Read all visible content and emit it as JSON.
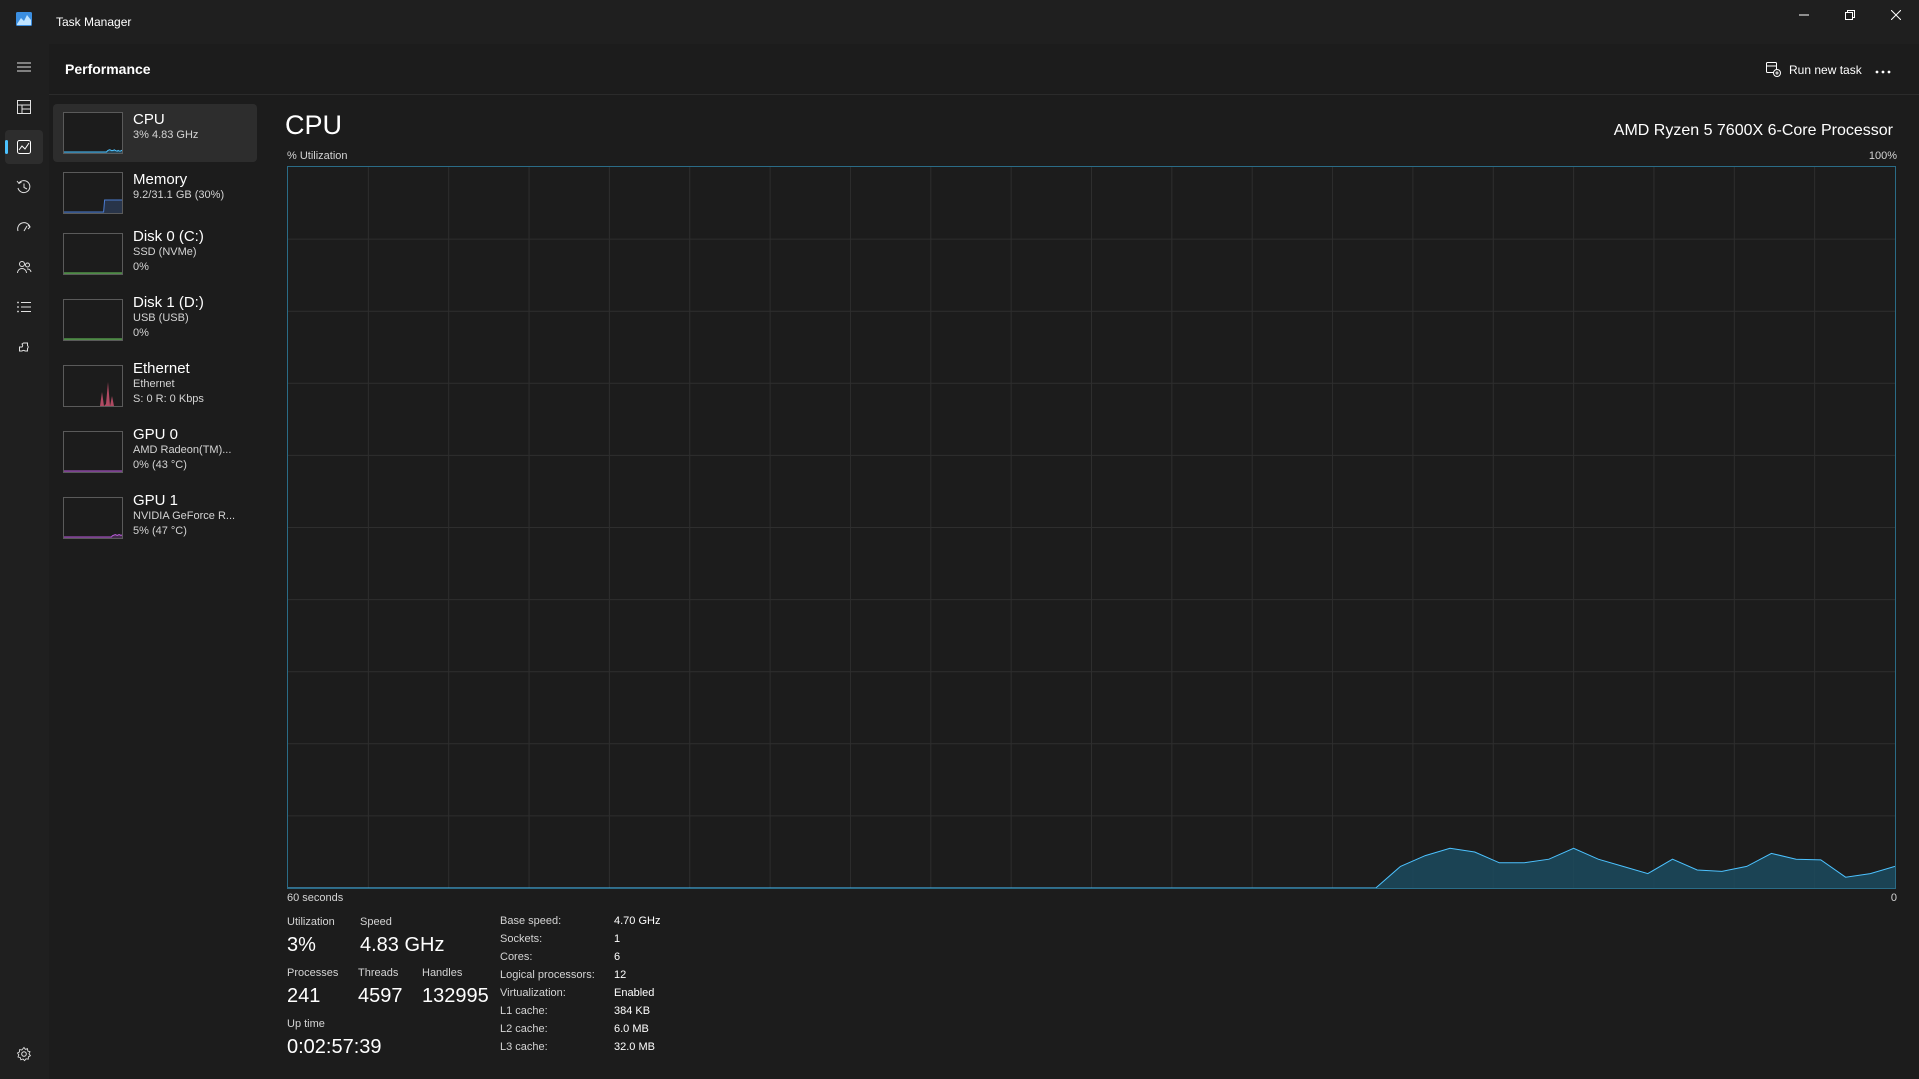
{
  "window": {
    "title": "Task Manager",
    "icon": "task-manager-logo-icon",
    "controls": [
      "minimize-icon",
      "restore-icon",
      "close-icon"
    ]
  },
  "nav": {
    "items": [
      "hamburger-menu-icon",
      "processes-icon",
      "performance-icon",
      "app-history-icon",
      "startup-apps-icon",
      "users-icon",
      "details-icon",
      "services-icon"
    ],
    "active": "performance-icon",
    "footer": "settings-gear-icon"
  },
  "header": {
    "title": "Performance",
    "run_new_task": "Run new task",
    "more_icon": "more-options-icon"
  },
  "resources": [
    {
      "name": "CPU",
      "sub1": "3%  4.83 GHz",
      "sub2": "",
      "graph_color": "#4cc2ff"
    },
    {
      "name": "Memory",
      "sub1": "9.2/31.1 GB (30%)",
      "sub2": "",
      "graph_color": "#4a7bd1"
    },
    {
      "name": "Disk 0 (C:)",
      "sub1": "SSD (NVMe)",
      "sub2": "0%",
      "graph_color": "#6ccb5f"
    },
    {
      "name": "Disk 1 (D:)",
      "sub1": "USB (USB)",
      "sub2": "0%",
      "graph_color": "#6ccb5f"
    },
    {
      "name": "Ethernet",
      "sub1": "Ethernet",
      "sub2": "S: 0  R: 0 Kbps",
      "graph_color": "#e0597a"
    },
    {
      "name": "GPU 0",
      "sub1": "AMD Radeon(TM)...",
      "sub2": "0% (43 °C)",
      "graph_color": "#b65ad6"
    },
    {
      "name": "GPU 1",
      "sub1": "NVIDIA GeForce R...",
      "sub2": "5% (47 °C)",
      "graph_color": "#b65ad6"
    }
  ],
  "detail": {
    "title": "CPU",
    "model": "AMD Ryzen 5 7600X 6-Core Processor",
    "y_label": "% Utilization",
    "y_max_label": "100%",
    "x_left_label": "60 seconds",
    "x_right_label": "0"
  },
  "chart_data": {
    "type": "area",
    "title": "",
    "xlabel": "60 seconds",
    "ylabel": "% Utilization",
    "xlim": [
      60,
      0
    ],
    "ylim": [
      0,
      100
    ],
    "grid": true,
    "color": "#4cc2ff",
    "x_seconds_ago": [
      60,
      59,
      58,
      57,
      56,
      55,
      54,
      53,
      52,
      51,
      50,
      49,
      48,
      47,
      46,
      45,
      44,
      43,
      42,
      41,
      40,
      39,
      38,
      37,
      36,
      35,
      34,
      33,
      32,
      31,
      30,
      29,
      28,
      27,
      26,
      25,
      24,
      23,
      22,
      21,
      20,
      19,
      18,
      17,
      16,
      15,
      14,
      13,
      12,
      11,
      10,
      9,
      8,
      7,
      6,
      5,
      4,
      3,
      2,
      1,
      0
    ],
    "values": [
      0,
      0,
      0,
      0,
      0,
      0,
      0,
      0,
      0,
      0,
      0,
      0,
      0,
      0,
      0,
      0,
      0,
      0,
      0,
      0,
      0,
      0,
      0,
      0,
      0,
      0,
      0,
      0,
      0,
      0,
      0,
      0,
      0,
      0,
      0,
      0,
      0,
      0,
      0,
      0,
      0,
      0,
      0,
      0,
      0,
      3,
      4.5,
      5.5,
      5,
      3.5,
      3.5,
      4,
      5.5,
      4,
      3,
      2,
      4,
      2.5,
      2.3,
      3,
      4.8,
      4,
      3.9,
      1.5,
      2,
      3
    ],
    "thumbnails": {
      "CPU": [
        0,
        0,
        0,
        0,
        0,
        0,
        0,
        0,
        0,
        0,
        0,
        0,
        0,
        0,
        0,
        0,
        0,
        0,
        0,
        0,
        0,
        0,
        0,
        0,
        0,
        0,
        0,
        0,
        0,
        0,
        0,
        0,
        0,
        0,
        0,
        0,
        0,
        0,
        0,
        0,
        0,
        0,
        0,
        0,
        0,
        3,
        4.5,
        5.5,
        5,
        3.5,
        3.5,
        4,
        5.5,
        4,
        3,
        2,
        4,
        2.5,
        2.3,
        3,
        4.8
      ],
      "Memory": [
        0,
        0,
        0,
        0,
        0,
        0,
        0,
        0,
        0,
        0,
        0,
        0,
        0,
        0,
        0,
        0,
        0,
        0,
        0,
        0,
        0,
        0,
        0,
        0,
        0,
        0,
        0,
        0,
        0,
        0,
        0,
        0,
        0,
        0,
        0,
        0,
        0,
        0,
        0,
        0,
        0,
        0,
        30,
        30,
        30,
        30,
        30,
        30,
        30,
        30,
        30,
        30,
        30,
        30,
        30,
        30,
        30,
        30,
        30,
        30,
        30
      ],
      "Disk 0 (C:)": [
        0,
        0,
        0,
        0,
        0,
        0,
        0,
        0,
        0,
        0,
        0,
        0,
        0,
        0,
        0,
        0,
        0,
        0,
        0,
        0,
        0,
        0,
        0,
        0,
        0,
        0,
        0,
        0,
        0,
        0,
        0,
        0,
        0,
        0,
        0,
        0,
        0,
        0,
        0,
        0,
        0,
        0,
        0,
        0,
        0,
        0,
        0,
        0,
        0,
        0,
        0,
        0,
        0,
        0,
        0,
        0,
        0,
        0,
        0,
        0,
        0
      ],
      "Disk 1 (D:)": [
        0,
        0,
        0,
        0,
        0,
        0,
        0,
        0,
        0,
        0,
        0,
        0,
        0,
        0,
        0,
        0,
        0,
        0,
        0,
        0,
        0,
        0,
        0,
        0,
        0,
        0,
        0,
        0,
        0,
        0,
        0,
        0,
        0,
        0,
        0,
        0,
        0,
        0,
        0,
        0,
        0,
        0,
        0,
        0,
        0,
        0,
        0,
        0,
        0,
        0,
        0,
        0,
        0,
        0,
        0,
        0,
        0,
        0,
        0,
        0,
        0
      ],
      "Ethernet": [
        0,
        0,
        0,
        0,
        0,
        0,
        0,
        0,
        0,
        0,
        0,
        0,
        0,
        0,
        0,
        0,
        0,
        0,
        0,
        0,
        0,
        0,
        0,
        0,
        0,
        0,
        0,
        0,
        0,
        0,
        0,
        0,
        0,
        0,
        0,
        0,
        0,
        0,
        0,
        0,
        0,
        0,
        0,
        0,
        0,
        0,
        0,
        0,
        0,
        0,
        0,
        0,
        0,
        0,
        0,
        0,
        0,
        0,
        0,
        0,
        0
      ],
      "GPU 0": [
        0,
        0,
        0,
        0,
        0,
        0,
        0,
        0,
        0,
        0,
        0,
        0,
        0,
        0,
        0,
        0,
        0,
        0,
        0,
        0,
        0,
        0,
        0,
        0,
        0,
        0,
        0,
        0,
        0,
        0,
        0,
        0,
        0,
        0,
        0,
        0,
        0,
        0,
        0,
        0,
        0,
        0,
        0,
        0,
        0,
        0,
        0,
        0,
        0,
        0,
        0,
        0,
        0,
        0,
        0,
        0,
        0,
        0,
        0,
        0,
        0
      ],
      "GPU 1": [
        0,
        0,
        0,
        0,
        0,
        0,
        0,
        0,
        0,
        0,
        0,
        0,
        0,
        0,
        0,
        0,
        0,
        0,
        0,
        0,
        0,
        0,
        0,
        0,
        0,
        0,
        0,
        0,
        0,
        0,
        0,
        0,
        0,
        0,
        0,
        0,
        0,
        0,
        0,
        0,
        0,
        0,
        0,
        0,
        0,
        0,
        0,
        0,
        0,
        0,
        3,
        4,
        5,
        6,
        5,
        4,
        5,
        6,
        5,
        4,
        5
      ]
    }
  },
  "stats": {
    "utilization": {
      "label": "Utilization",
      "value": "3%"
    },
    "speed": {
      "label": "Speed",
      "value": "4.83 GHz"
    },
    "processes": {
      "label": "Processes",
      "value": "241"
    },
    "threads": {
      "label": "Threads",
      "value": "4597"
    },
    "handles": {
      "label": "Handles",
      "value": "132995"
    },
    "uptime": {
      "label": "Up time",
      "value": "0:02:57:39"
    }
  },
  "specs": [
    {
      "key": "Base speed:",
      "value": "4.70 GHz"
    },
    {
      "key": "Sockets:",
      "value": "1"
    },
    {
      "key": "Cores:",
      "value": "6"
    },
    {
      "key": "Logical processors:",
      "value": "12"
    },
    {
      "key": "Virtualization:",
      "value": "Enabled"
    },
    {
      "key": "L1 cache:",
      "value": "384 KB"
    },
    {
      "key": "L2 cache:",
      "value": "6.0 MB"
    },
    {
      "key": "L3 cache:",
      "value": "32.0 MB"
    }
  ]
}
